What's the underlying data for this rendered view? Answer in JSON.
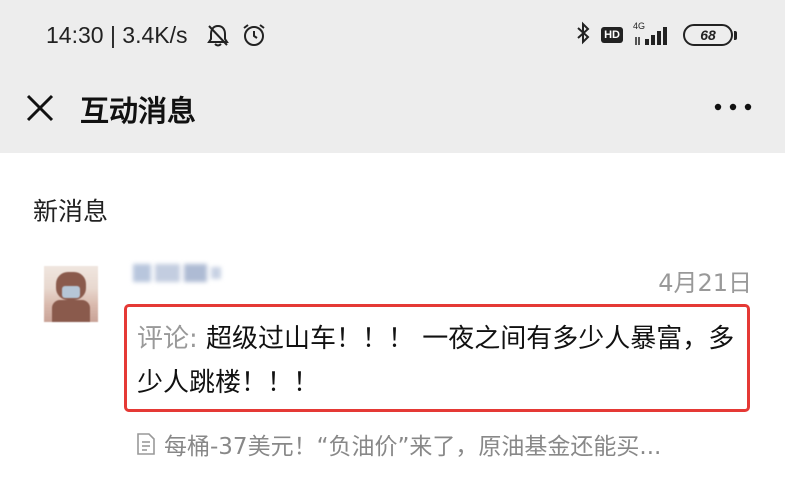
{
  "status_bar": {
    "time_speed": "14:30 | 3.4K/s",
    "hd_label": "HD",
    "network_label": "4G",
    "battery_level": "68"
  },
  "nav": {
    "title": "互动消息"
  },
  "section": {
    "label": "新消息"
  },
  "message": {
    "date": "4月21日",
    "comment_prefix": "评论: ",
    "comment_body": "超级过山车！！！ 一夜之间有多少人暴富，多少人跳楼！！！",
    "source_title": "每桶-37美元！“负油价”来了，原油基金还能买..."
  },
  "colors": {
    "highlight_border": "#e53935",
    "header_bg": "#ededed"
  }
}
